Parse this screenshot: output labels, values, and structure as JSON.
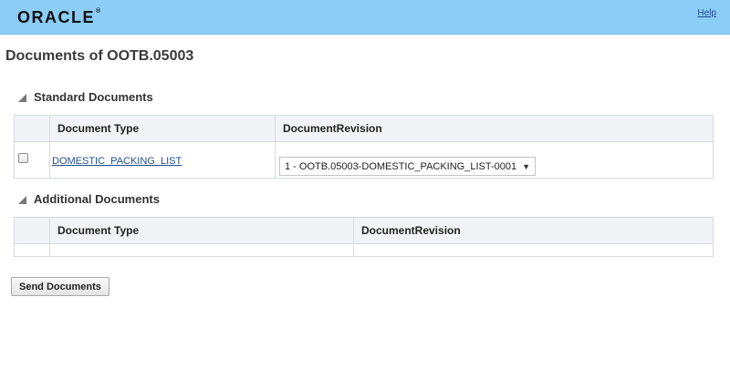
{
  "header": {
    "logo_text": "ORACLE",
    "logo_mark": "®",
    "help_label": "Help"
  },
  "page": {
    "title": "Documents of OOTB.05003"
  },
  "standard_documents": {
    "section_title": "Standard Documents",
    "columns": [
      "Document Type",
      "DocumentRevision"
    ],
    "rows": [
      {
        "selected": false,
        "document_type": "DOMESTIC_PACKING_LIST",
        "revision": "1 - OOTB.05003-DOMESTIC_PACKING_LIST-0001"
      }
    ]
  },
  "additional_documents": {
    "section_title": "Additional Documents",
    "columns": [
      "Document Type",
      "DocumentRevision"
    ],
    "rows": []
  },
  "actions": {
    "send_label": "Send Documents"
  },
  "icons": {
    "dropdown": "triangle-down-icon",
    "section_toggle": "disclosure-triangle-icon"
  }
}
